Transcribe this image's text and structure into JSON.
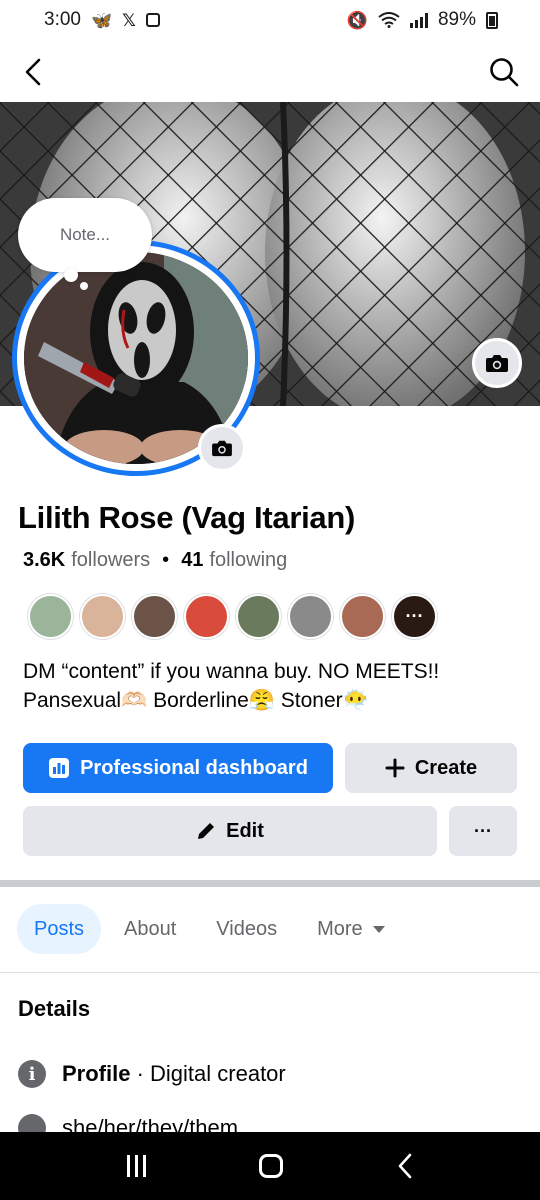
{
  "status_bar": {
    "time": "3:00",
    "battery": "89%"
  },
  "note": {
    "placeholder": "Note..."
  },
  "profile": {
    "name": "Lilith Rose (Vag Itarian)",
    "followers_count": "3.6K",
    "followers_label": "followers",
    "following_count": "41",
    "following_label": "following"
  },
  "friends": [
    {
      "color": "#9bb59a"
    },
    {
      "color": "#d9b49a"
    },
    {
      "color": "#6b5347"
    },
    {
      "color": "#d94b3b"
    },
    {
      "color": "#6a7a5c"
    },
    {
      "color": "#8a8a8a"
    },
    {
      "color": "#a86a55"
    },
    {
      "color": "#2a1a14",
      "label": "···"
    }
  ],
  "bio": {
    "line1": "DM “content” if you wanna buy. NO MEETS!!",
    "line2_a": "Pansexual",
    "emoji_a": "🫶🏻",
    "line2_b": " Borderline",
    "emoji_b": "😤",
    "line2_c": " Stoner",
    "emoji_c": "😶‍🌫️"
  },
  "buttons": {
    "dashboard": "Professional dashboard",
    "create": "Create",
    "edit": "Edit",
    "more": "···"
  },
  "tabs": [
    {
      "label": "Posts"
    },
    {
      "label": "About"
    },
    {
      "label": "Videos"
    },
    {
      "label": "More"
    }
  ],
  "details": {
    "heading": "Details",
    "profile_label": "Profile",
    "profile_sep": " · ",
    "profile_value": "Digital creator",
    "pronouns": "she/her/they/them"
  },
  "colors": {
    "accent": "#1877f2",
    "button_gray": "#e4e6eb",
    "text_secondary": "#65676b"
  }
}
